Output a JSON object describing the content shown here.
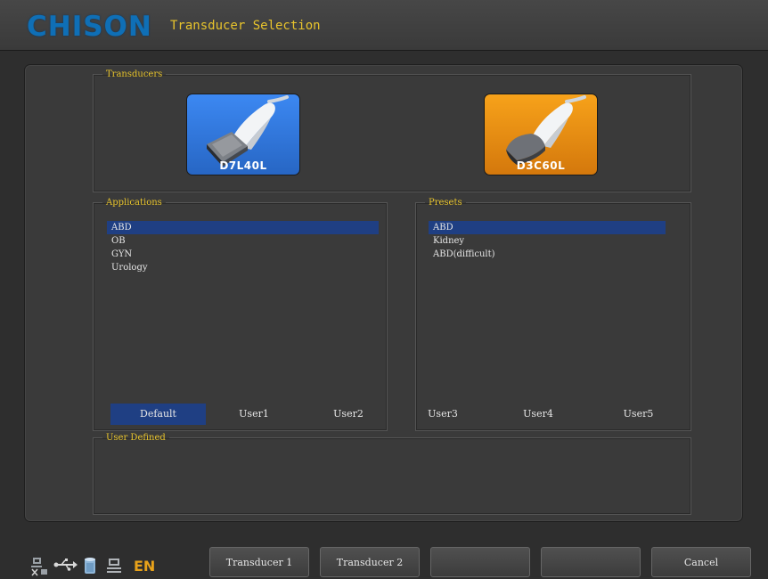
{
  "header": {
    "logo": "CHISON",
    "title": "Transducer Selection"
  },
  "transducers": {
    "legend": "Transducers",
    "items": [
      {
        "label": "D7L40L",
        "color": "#3a86ef"
      },
      {
        "label": "D3C60L",
        "color": "#f29a16"
      }
    ]
  },
  "applications": {
    "legend": "Applications",
    "items": [
      "ABD",
      "OB",
      "GYN",
      "Urology"
    ],
    "selected": "ABD"
  },
  "presets": {
    "legend": "Presets",
    "items": [
      "ABD",
      "Kidney",
      "ABD(difficult)"
    ],
    "selected": "ABD"
  },
  "user_defined": {
    "legend": "User Defined",
    "items": [
      "Default",
      "User1",
      "User2",
      "User3",
      "User4",
      "User5"
    ],
    "selected": "Default"
  },
  "bottom_buttons": [
    "Transducer 1",
    "Transducer 2",
    "",
    "",
    "Cancel"
  ],
  "status_bar": {
    "icons": [
      "network-icon",
      "usb-icon",
      "storage-icon",
      "printer-icon"
    ],
    "language": "EN",
    "language_color": "#e8a21a"
  },
  "colors": {
    "accent_text": "#e8c42c",
    "selection": "#1f3f83"
  }
}
